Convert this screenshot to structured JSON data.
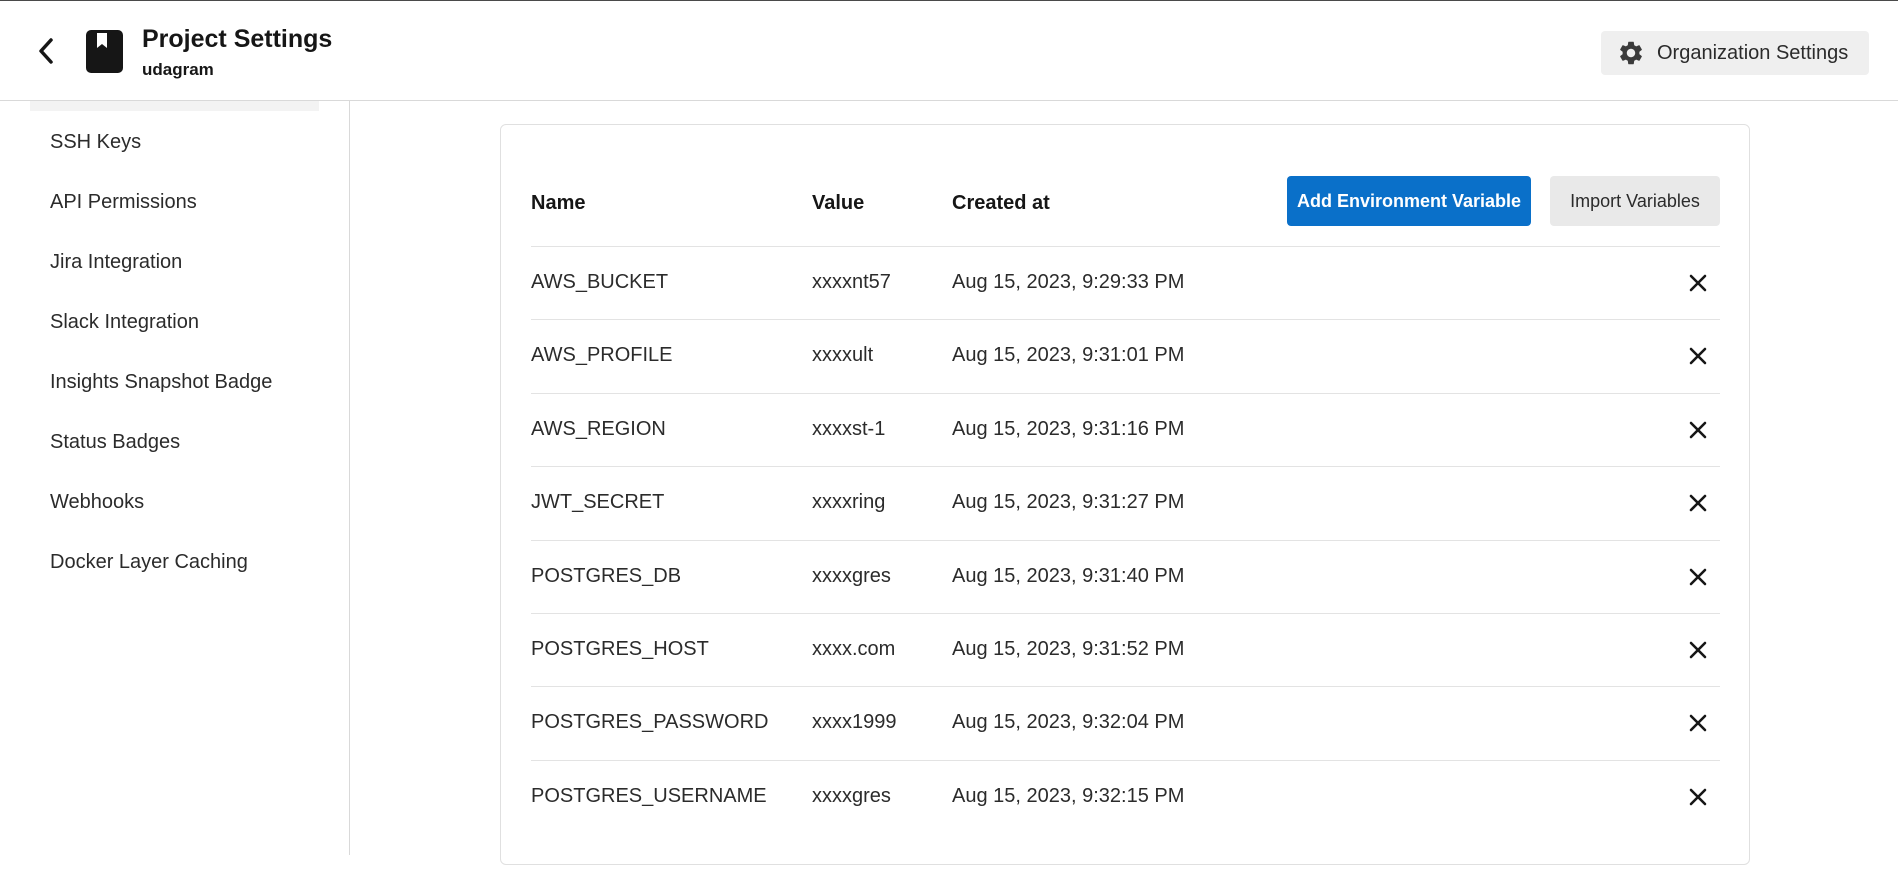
{
  "header": {
    "title": "Project Settings",
    "project": "udagram",
    "org_settings_label": "Organization Settings"
  },
  "sidebar": {
    "items": [
      {
        "label": "SSH Keys"
      },
      {
        "label": "API Permissions"
      },
      {
        "label": "Jira Integration"
      },
      {
        "label": "Slack Integration"
      },
      {
        "label": "Insights Snapshot Badge"
      },
      {
        "label": "Status Badges"
      },
      {
        "label": "Webhooks"
      },
      {
        "label": "Docker Layer Caching"
      }
    ]
  },
  "table": {
    "columns": {
      "name": "Name",
      "value": "Value",
      "created": "Created at"
    },
    "add_button": "Add Environment Variable",
    "import_button": "Import Variables",
    "rows": [
      {
        "name": "AWS_BUCKET",
        "value": "xxxxnt57",
        "created": "Aug 15, 2023, 9:29:33 PM"
      },
      {
        "name": "AWS_PROFILE",
        "value": "xxxxult",
        "created": "Aug 15, 2023, 9:31:01 PM"
      },
      {
        "name": "AWS_REGION",
        "value": "xxxxst-1",
        "created": "Aug 15, 2023, 9:31:16 PM"
      },
      {
        "name": "JWT_SECRET",
        "value": "xxxxring",
        "created": "Aug 15, 2023, 9:31:27 PM"
      },
      {
        "name": "POSTGRES_DB",
        "value": "xxxxgres",
        "created": "Aug 15, 2023, 9:31:40 PM"
      },
      {
        "name": "POSTGRES_HOST",
        "value": "xxxx.com",
        "created": "Aug 15, 2023, 9:31:52 PM"
      },
      {
        "name": "POSTGRES_PASSWORD",
        "value": "xxxx1999",
        "created": "Aug 15, 2023, 9:32:04 PM"
      },
      {
        "name": "POSTGRES_USERNAME",
        "value": "xxxxgres",
        "created": "Aug 15, 2023, 9:32:15 PM"
      }
    ]
  },
  "icons": {
    "back": "chevron-left-icon",
    "project": "bookmark-icon",
    "org_settings": "gear-icon",
    "delete": "close-icon"
  },
  "colors": {
    "primary": "#0a70c9",
    "secondary_button": "#e9e9e9"
  }
}
